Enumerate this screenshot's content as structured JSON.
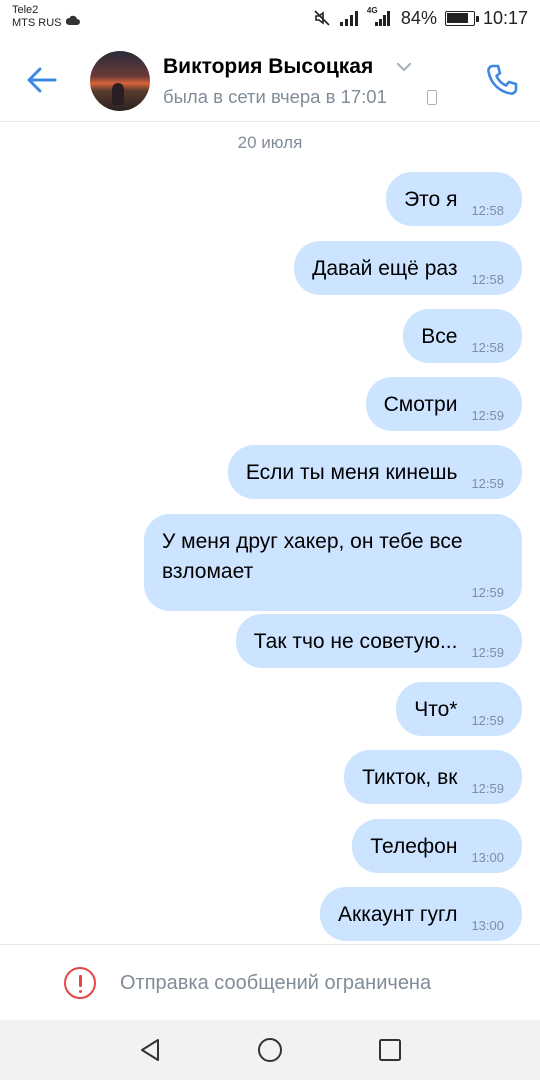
{
  "status_bar": {
    "carrier_1": "Tele2",
    "carrier_2": "MTS RUS",
    "network": "4G",
    "battery": "84%",
    "battery_level": 0.84,
    "time": "10:17"
  },
  "header": {
    "name": "Виктория Высоцкая",
    "status": "была в сети вчера в 17:01"
  },
  "chat": {
    "date": "20 июля",
    "messages": [
      {
        "text": "Это я",
        "time": "12:58"
      },
      {
        "text": "Давай ещё раз",
        "time": "12:58"
      },
      {
        "text": "Все",
        "time": "12:58"
      },
      {
        "text": "Смотри",
        "time": "12:59"
      },
      {
        "text": "Если ты меня кинешь",
        "time": "12:59"
      },
      {
        "text": "У меня друг хакер, он тебе все взломает",
        "time": "12:59"
      },
      {
        "text": "Так тчо не советую...",
        "time": "12:59"
      },
      {
        "text": "Что*",
        "time": "12:59"
      },
      {
        "text": "Тикток, вк",
        "time": "12:59"
      },
      {
        "text": "Телефон",
        "time": "13:00"
      },
      {
        "text": "Аккаунт гугл",
        "time": "13:00"
      }
    ]
  },
  "restriction": {
    "text": "Отправка сообщений ограничена"
  },
  "colors": {
    "accent": "#3f8ae0",
    "bubble": "#cce4ff",
    "secondary_text": "#818c99",
    "warning": "#e64646"
  },
  "icons": {
    "back": "arrow-left-icon",
    "call": "phone-icon",
    "warning": "exclamation-circle-icon",
    "nav_back": "triangle-back-icon",
    "nav_home": "circle-home-icon",
    "nav_recents": "square-recents-icon"
  }
}
